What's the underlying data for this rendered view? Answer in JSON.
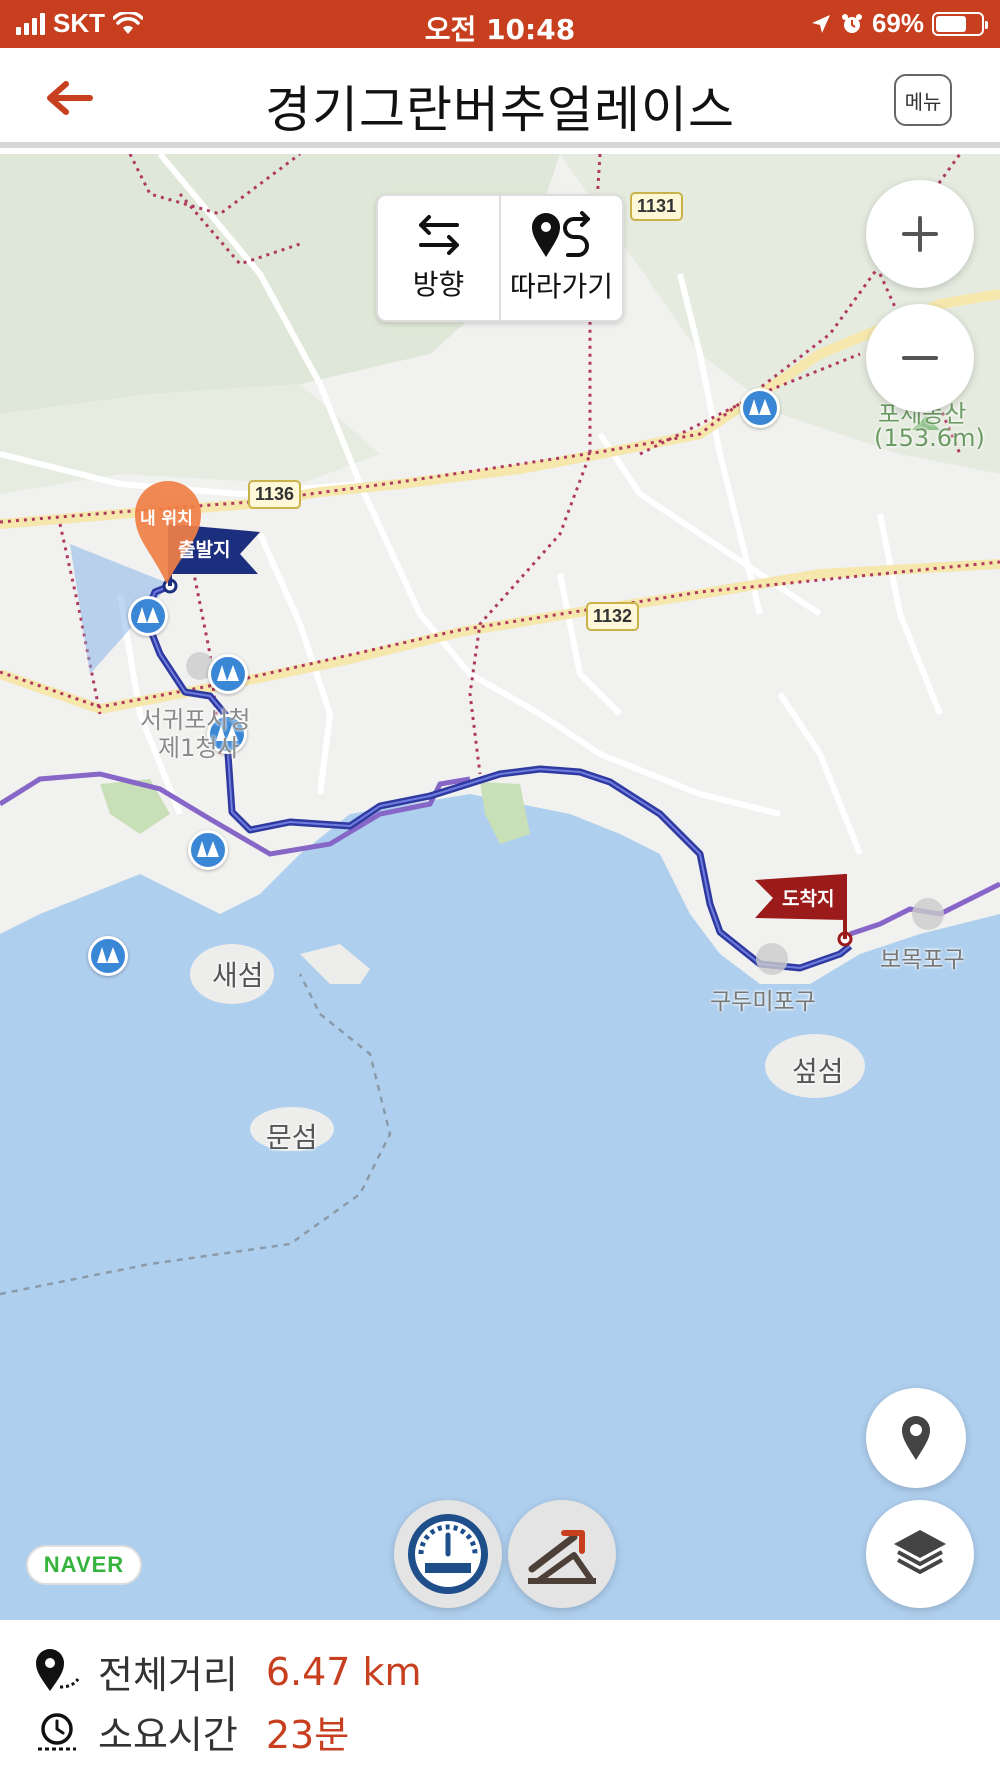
{
  "status_bar": {
    "carrier": "SKT",
    "time": "오전 10:48",
    "battery": "69%",
    "battery_level": 0.69
  },
  "header": {
    "title": "경기그란버추얼레이스",
    "menu_label": "메뉴",
    "back_icon": "arrow-left-icon"
  },
  "map": {
    "direction_panel": {
      "direction_label": "방향",
      "follow_label": "따라가기"
    },
    "zoom_in": "+",
    "zoom_out": "−",
    "road_signs": [
      "1131",
      "1136",
      "1132"
    ],
    "place_labels": {
      "mountain": "포제동산",
      "mountain_height": "(153.6m)",
      "city_hall_1": "서귀포시청",
      "city_hall_2": "제1청사",
      "saeseom": "새섬",
      "munseom": "문섬",
      "seopseom": "섶섬",
      "gudumi": "구두미포구",
      "bomok": "보목포구"
    },
    "my_location_label": "내 위치",
    "start_flag_label": "출발지",
    "end_flag_label": "도착지",
    "provider_logo": "NAVER",
    "colors": {
      "route": "#2f3aa0",
      "sea": "#aecfee",
      "start_flag": "#1c2f7e",
      "end_flag": "#9b1b1b",
      "accent": "#c73f1f"
    }
  },
  "route_info": {
    "distance_label": "전체거리",
    "distance_value": "6.47 km",
    "time_label": "소요시간",
    "time_value": "23분"
  }
}
